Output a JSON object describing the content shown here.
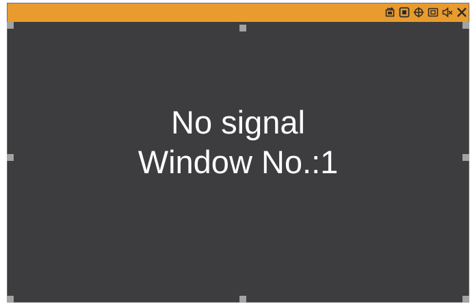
{
  "window": {
    "status_line": "No signal",
    "window_label": "Window No.:1"
  },
  "colors": {
    "title_bar": "#e99b2e",
    "video_background": "#3d3c3e",
    "text": "#ffffff",
    "handles": "#a3a3a3"
  },
  "toolbar": {
    "buttons": [
      {
        "name": "source-switch-icon"
      },
      {
        "name": "fullscreen-icon"
      },
      {
        "name": "move-icon"
      },
      {
        "name": "restore-icon"
      },
      {
        "name": "mute-icon"
      },
      {
        "name": "close-icon"
      }
    ]
  }
}
